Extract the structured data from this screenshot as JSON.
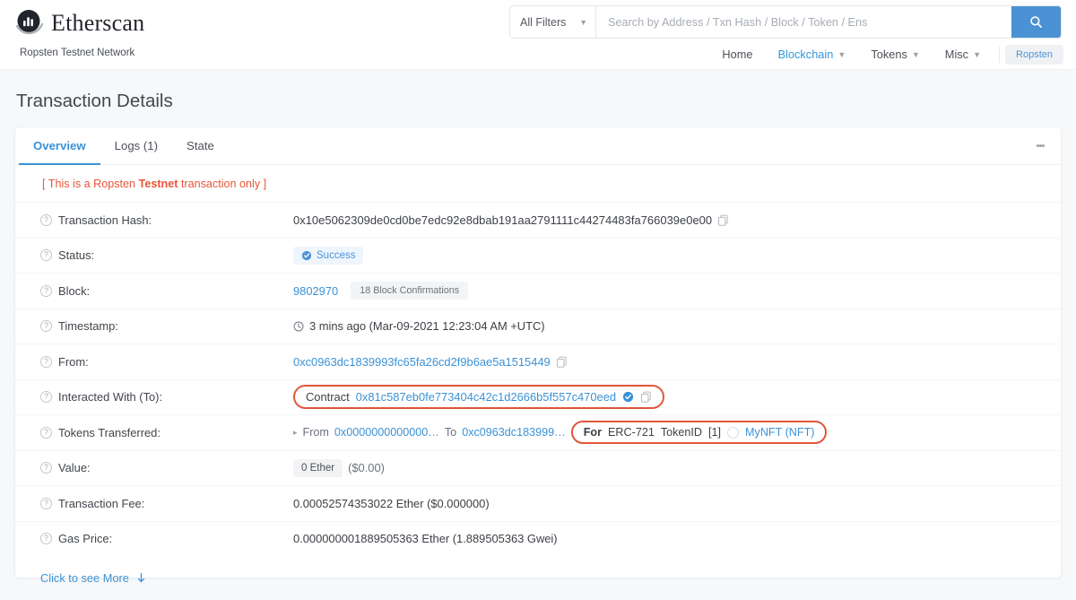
{
  "header": {
    "brand_name": "Etherscan",
    "network_subtitle": "Ropsten Testnet Network",
    "filters_label": "All Filters",
    "search_placeholder": "Search by Address / Txn Hash / Block / Token / Ens",
    "search_icon": "search-icon",
    "nav": [
      {
        "label": "Home",
        "active": false,
        "has_caret": false
      },
      {
        "label": "Blockchain",
        "active": true,
        "has_caret": true
      },
      {
        "label": "Tokens",
        "active": false,
        "has_caret": true
      },
      {
        "label": "Misc",
        "active": false,
        "has_caret": true
      }
    ],
    "network_pill": "Ropsten",
    "accent_blue": "#3b92d6",
    "search_button_color": "#4a92d4"
  },
  "page": {
    "title": "Transaction Details"
  },
  "tabs": [
    {
      "label": "Overview",
      "active": true
    },
    {
      "label": "Logs (1)",
      "active": false
    },
    {
      "label": "State",
      "active": false
    }
  ],
  "kebab_menu": "more-options",
  "testnet_note": {
    "prefix": "[ This is a Ropsten ",
    "bold": "Testnet",
    "suffix": " transaction only ]",
    "color": "#e8553a"
  },
  "rows": {
    "txn_hash": {
      "label": "Transaction Hash:",
      "value": "0x10e5062309de0cd0be7edc92e8dbab191aa2791111c44274483fa766039e0e00"
    },
    "status": {
      "label": "Status:",
      "value": "Success"
    },
    "block": {
      "label": "Block:",
      "value": "9802970",
      "confirmations": "18 Block Confirmations"
    },
    "timestamp": {
      "label": "Timestamp:",
      "value": "3 mins ago (Mar-09-2021 12:23:04 AM +UTC)"
    },
    "from": {
      "label": "From:",
      "value": "0xc0963dc1839993fc65fa26cd2f9b6ae5a1515449"
    },
    "interacted_with": {
      "label": "Interacted With (To):",
      "prefix": "Contract",
      "address": "0x81c587eb0fe773404c42c1d2666b5f557c470eed",
      "highlighted": true
    },
    "tokens_transferred": {
      "label": "Tokens Transferred:",
      "from_label": "From",
      "from_address": "0x0000000000000…",
      "to_label": "To",
      "to_address": "0xc0963dc183999…",
      "for_label": "For",
      "token_standard": "ERC-721",
      "token_id_label": "TokenID",
      "token_id": "[1]",
      "token_name": "MyNFT (NFT)",
      "highlighted": true
    },
    "value": {
      "label": "Value:",
      "amount": "0 Ether",
      "fiat": "($0.00)"
    },
    "txn_fee": {
      "label": "Transaction Fee:",
      "value": "0.00052574353022 Ether ($0.000000)"
    },
    "gas_price": {
      "label": "Gas Price:",
      "value": "0.000000001889505363 Ether (1.889505363 Gwei)"
    }
  },
  "footer": {
    "see_more": "Click to see More"
  },
  "annotation_color": "#e0563a"
}
